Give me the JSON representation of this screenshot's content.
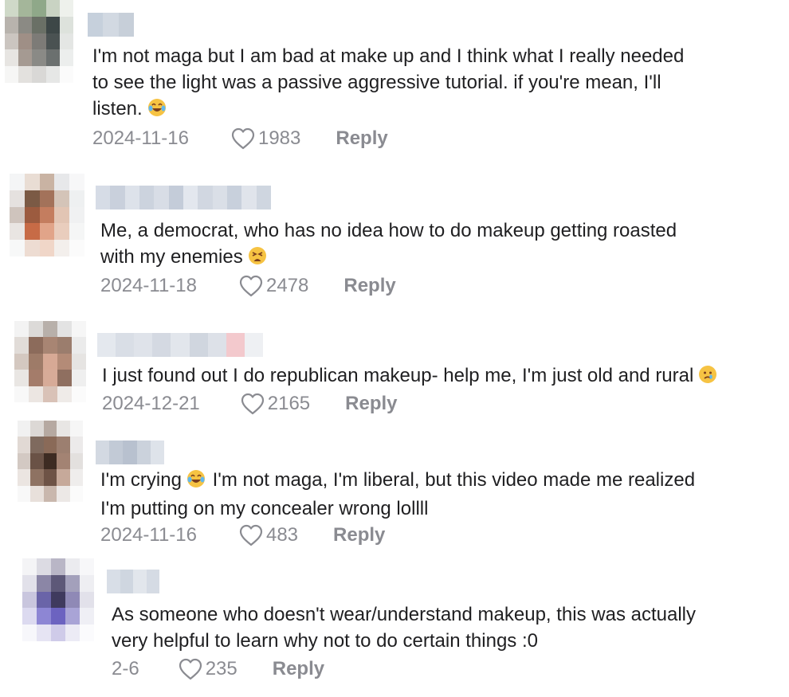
{
  "comments": [
    {
      "text": "I'm not maga but I am bad at make up and I think what I really needed\nto see the light was a passive aggressive tutorial. if you're mean, I'll\nlisten.",
      "emoji": "laughing-crying-emoji",
      "date": "2024-11-16",
      "likes": "1983",
      "reply_label": "Reply",
      "avatar_colors": [
        "#cfd9c8",
        "#a4b69a",
        "#8fa889",
        "#c9d3c3",
        "#eef1ec",
        "#b8b3ad",
        "#8b8a84",
        "#6a7066",
        "#3d4747",
        "#dde2dc",
        "#cbc5c0",
        "#9f8f86",
        "#7d7b77",
        "#4a5252",
        "#e4e6e4",
        "#e7e5e2",
        "#a59a92",
        "#8a8a86",
        "#6b706f",
        "#eceeed",
        "#f6f6f5",
        "#e3e1de",
        "#d9d8d6",
        "#e6e7e6",
        "#fbfbfb"
      ],
      "username_colors": [
        "#c6d0dc",
        "#d2d9e2",
        "#c7cfd9"
      ]
    },
    {
      "text": "Me, a democrat, who has no idea how to do makeup getting roasted\nwith my enemies",
      "emoji": "weary-face-emoji",
      "date": "2024-11-18",
      "likes": "2478",
      "reply_label": "Reply",
      "avatar_colors": [
        "#f4f5f6",
        "#e9ddd4",
        "#c9b3a3",
        "#e7e8ea",
        "#f7f7f8",
        "#e5e1df",
        "#7b5a45",
        "#a3725a",
        "#d4c4b8",
        "#eef0f1",
        "#cfc4bd",
        "#9c5b3f",
        "#c47d5f",
        "#e2c5b4",
        "#f0f1f2",
        "#e9e5e2",
        "#c76b46",
        "#e1a489",
        "#e9cdbd",
        "#f5f6f6",
        "#f7f8f8",
        "#eddcd2",
        "#f0d6c8",
        "#f3efec",
        "#fbfbfb"
      ],
      "username_colors": [
        "#d6dce6",
        "#c9d0dc",
        "#dde2ea",
        "#ccd3de",
        "#d8dde6",
        "#c4ccd9",
        "#e3e7ee",
        "#d1d7e1",
        "#dadfe7",
        "#c8d0dc",
        "#e0e4eb",
        "#cfd6e0"
      ]
    },
    {
      "text": "I just found out I do republican makeup- help me, I'm just old and rural",
      "emoji": "crying-face-emoji",
      "date": "2024-12-21",
      "likes": "2165",
      "reply_label": "Reply",
      "avatar_colors": [
        "#f3f3f3",
        "#dcdad8",
        "#b8b0aa",
        "#e3e3e3",
        "#f6f6f6",
        "#e1dcd8",
        "#8c6b5b",
        "#a88573",
        "#9b7d6d",
        "#ebebeb",
        "#d4c8c0",
        "#9e7b68",
        "#d7a995",
        "#b48b77",
        "#e6e4e2",
        "#e9e6e3",
        "#a47c6a",
        "#d7ab98",
        "#8f6f60",
        "#efefef",
        "#f8f8f8",
        "#ece6e2",
        "#d9c2b7",
        "#efebe8",
        "#fbfbfb"
      ],
      "username_colors": [
        "#e4e8ee",
        "#d9dee6",
        "#dfe3ea",
        "#d4d9e2",
        "#e2e6ec",
        "#d0d6df",
        "#dde1e8",
        "#f3c9cd",
        "#eef0f3"
      ]
    },
    {
      "text": "I'm crying",
      "text_after": " I'm not maga, I'm liberal, but this video made me realized\nI'm putting on my concealer wrong lollll",
      "emoji": "laughing-crying-emoji",
      "date": "2024-11-16",
      "likes": "483",
      "reply_label": "Reply",
      "avatar_colors": [
        "#f1f1f1",
        "#dcd8d5",
        "#b6a9a1",
        "#e8e6e4",
        "#f6f6f6",
        "#e1d9d4",
        "#7f6a5e",
        "#8a6a58",
        "#9c7f70",
        "#eceaea",
        "#d3c9c3",
        "#6a5246",
        "#3d2b22",
        "#a38373",
        "#e3e0de",
        "#ebe5e1",
        "#8e7262",
        "#6e5346",
        "#c6a99a",
        "#efedec",
        "#f8f8f8",
        "#e8e0db",
        "#c9b7ad",
        "#ece8e6",
        "#fbfbfb"
      ],
      "username_colors": [
        "#d3d9e2",
        "#c2cad6",
        "#b8c1cf",
        "#cbd2dc",
        "#dee3ea"
      ]
    },
    {
      "text": "As someone who doesn't wear/understand makeup, this was actually\nvery helpful to learn why not to do certain things :0",
      "date": "2-6",
      "likes": "235",
      "reply_label": "Reply",
      "avatar_colors": [
        "#f4f4f6",
        "#dcdbe3",
        "#b9b6c6",
        "#ebebef",
        "#f7f7f9",
        "#e2e1ea",
        "#8b86a6",
        "#5d5878",
        "#a3a0bb",
        "#eeeef2",
        "#c9c6de",
        "#6a64a8",
        "#3f3a5e",
        "#8f89b6",
        "#e2e1ea",
        "#dcdaf0",
        "#8d86d4",
        "#6c63c0",
        "#a9a4d6",
        "#efeff5",
        "#f7f7fb",
        "#e6e4f3",
        "#cfcbe9",
        "#ecebf5",
        "#fbfbfd"
      ],
      "username_colors": [
        "#d8dee7",
        "#cfd6e0",
        "#e2e6ec",
        "#d5dbe4"
      ]
    }
  ],
  "icons": {
    "like": "heart-outline-icon"
  },
  "colors": {
    "meta_gray": "#8a8b91",
    "text": "#1f1f21"
  }
}
